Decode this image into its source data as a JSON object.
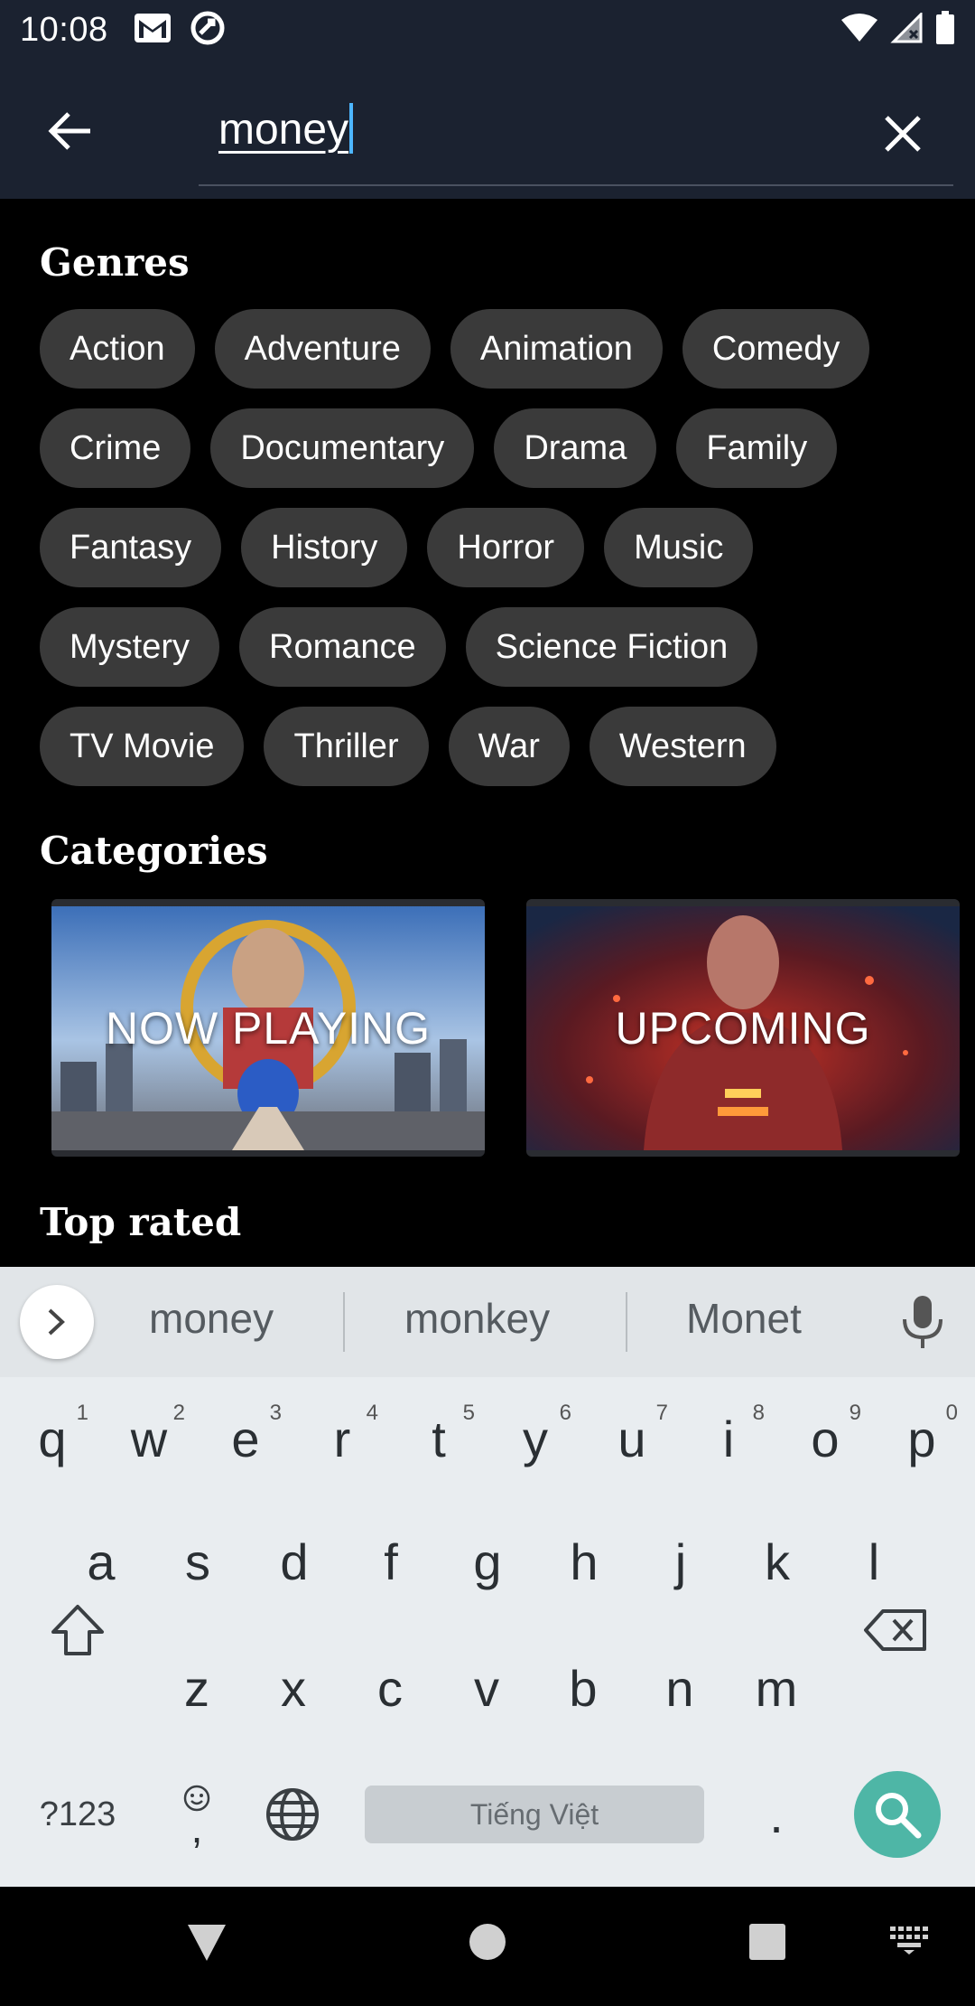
{
  "status_bar": {
    "time": "10:08",
    "icons": [
      "gmail-icon",
      "sync-icon",
      "wifi-icon",
      "signal-icon",
      "battery-icon"
    ]
  },
  "search": {
    "query": "money",
    "back_icon": "arrow-back-icon",
    "clear_icon": "close-icon"
  },
  "genres": {
    "title": "Genres",
    "rows": [
      [
        "Action",
        "Adventure",
        "Animation",
        "Comedy"
      ],
      [
        "Crime",
        "Documentary",
        "Drama",
        "Family"
      ],
      [
        "Fantasy",
        "History",
        "Horror",
        "Music"
      ],
      [
        "Mystery",
        "Romance",
        "Science Fiction"
      ],
      [
        "TV Movie",
        "Thriller",
        "War",
        "Western"
      ]
    ]
  },
  "categories": {
    "title": "Categories",
    "items": [
      {
        "label": "NOW PLAYING"
      },
      {
        "label": "UPCOMING"
      }
    ]
  },
  "top_rated": {
    "title": "Top rated"
  },
  "keyboard": {
    "suggestions": [
      "money",
      "monkey",
      "Monet"
    ],
    "row1": [
      {
        "k": "q",
        "n": "1"
      },
      {
        "k": "w",
        "n": "2"
      },
      {
        "k": "e",
        "n": "3"
      },
      {
        "k": "r",
        "n": "4"
      },
      {
        "k": "t",
        "n": "5"
      },
      {
        "k": "y",
        "n": "6"
      },
      {
        "k": "u",
        "n": "7"
      },
      {
        "k": "i",
        "n": "8"
      },
      {
        "k": "o",
        "n": "9"
      },
      {
        "k": "p",
        "n": "0"
      }
    ],
    "row2": [
      "a",
      "s",
      "d",
      "f",
      "g",
      "h",
      "j",
      "k",
      "l"
    ],
    "row3": [
      "z",
      "x",
      "c",
      "v",
      "b",
      "n",
      "m"
    ],
    "symbols_label": "?123",
    "comma": ",",
    "period": ".",
    "space_label": "Tiếng Việt",
    "accent_color": "#4eb6a6"
  },
  "nav_bar": {
    "icons": [
      "back-triangle-icon",
      "home-circle-icon",
      "recents-square-icon",
      "keyboard-icon"
    ]
  }
}
